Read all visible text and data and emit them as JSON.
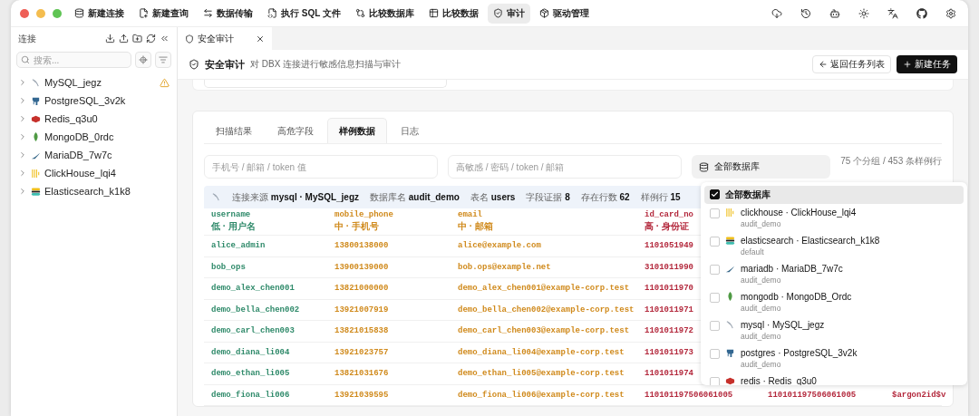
{
  "toolbar": {
    "items": [
      {
        "label": "新建连接",
        "selected": false
      },
      {
        "label": "新建查询",
        "selected": false
      },
      {
        "label": "数据传输",
        "selected": false
      },
      {
        "label": "执行 SQL 文件",
        "selected": false
      },
      {
        "label": "比较数据库",
        "selected": false
      },
      {
        "label": "比较数据",
        "selected": false
      },
      {
        "label": "审计",
        "selected": true
      },
      {
        "label": "驱动管理",
        "selected": false
      }
    ]
  },
  "sidebar": {
    "title": "连接",
    "search": {
      "placeholder": "搜索..."
    },
    "items": [
      {
        "label": "MySQL_jegz",
        "kind": "mysql",
        "warning": true
      },
      {
        "label": "PostgreSQL_3v2k",
        "kind": "postgres",
        "warning": false
      },
      {
        "label": "Redis_q3u0",
        "kind": "redis",
        "warning": false
      },
      {
        "label": "MongoDB_0rdc",
        "kind": "mongodb",
        "warning": false
      },
      {
        "label": "MariaDB_7w7c",
        "kind": "mariadb",
        "warning": false
      },
      {
        "label": "ClickHouse_lqi4",
        "kind": "clickhouse",
        "warning": false
      },
      {
        "label": "Elasticsearch_k1k8",
        "kind": "elasticsearch",
        "warning": false
      }
    ]
  },
  "doc_tab": {
    "label": "安全审计"
  },
  "header": {
    "title": "安全审计",
    "subtitle": "对 DBX 连接进行敏感信息扫描与审计",
    "back_button": "返回任务列表",
    "new_button": "新建任务"
  },
  "tabs": [
    {
      "label": "扫描结果",
      "selected": false
    },
    {
      "label": "高危字段",
      "selected": false
    },
    {
      "label": "样例数据",
      "selected": true
    },
    {
      "label": "日志",
      "selected": false
    }
  ],
  "filters": {
    "value_search": {
      "placeholder": "手机号 / 邮箱 / token 值"
    },
    "field_search": {
      "placeholder": "高敏感 / 密码 / token / 邮箱"
    },
    "database_select": "全部数据库",
    "summary": "75 个分组 / 453 条样例行"
  },
  "info_bar": [
    {
      "label": "连接来源",
      "value": "mysql · MySQL_jegz"
    },
    {
      "label": "数据库名",
      "value": "audit_demo"
    },
    {
      "label": "表名",
      "value": "users"
    },
    {
      "label": "字段证据",
      "value": "8"
    },
    {
      "label": "存在行数",
      "value": "62"
    },
    {
      "label": "样例行",
      "value": "15"
    }
  ],
  "table": {
    "columns": [
      {
        "name": "username",
        "tag": "低 · 用户名",
        "color": "#2f8a6a"
      },
      {
        "name": "mobile_phone",
        "tag": "中 · 手机号",
        "color": "#d08a1c"
      },
      {
        "name": "email",
        "tag": "中 · 邮箱",
        "color": "#d08a1c"
      },
      {
        "name": "id_card_no",
        "tag": "高 · 身份证",
        "color": "#b3283c"
      },
      {
        "color": "#b3283c"
      },
      {
        "color": "#b3283c"
      }
    ],
    "rows": [
      [
        "alice_admin",
        "13800138000",
        "alice@example.com",
        "1101051949"
      ],
      [
        "bob_ops",
        "13900139000",
        "bob.ops@example.net",
        "3101011990"
      ],
      [
        "demo_alex_chen001",
        "13821000000",
        "demo_alex_chen001@example-corp.test",
        "1101011970"
      ],
      [
        "demo_bella_chen002",
        "13921007919",
        "demo_bella_chen002@example-corp.test",
        "1101011971"
      ],
      [
        "demo_carl_chen003",
        "13821015838",
        "demo_carl_chen003@example-corp.test",
        "1101011972"
      ],
      [
        "demo_diana_li004",
        "13921023757",
        "demo_diana_li004@example-corp.test",
        "1101011973"
      ],
      [
        "demo_ethan_li005",
        "13821031676",
        "demo_ethan_li005@example-corp.test",
        "1101011974"
      ],
      [
        "demo_fiona_li006",
        "13921039595",
        "demo_fiona_li006@example-corp.test",
        "110101197506061005",
        "110101197506061005",
        "$argon2id$v"
      ]
    ]
  },
  "database_menu": {
    "items": [
      {
        "label": "全部数据库",
        "checked": true,
        "selected": true
      },
      {
        "label": "clickhouse · ClickHouse_lqi4",
        "sub": "audit_demo",
        "kind": "clickhouse",
        "checked": false,
        "selected": false
      },
      {
        "label": "elasticsearch · Elasticsearch_k1k8",
        "sub": "default",
        "kind": "elasticsearch",
        "checked": false,
        "selected": false
      },
      {
        "label": "mariadb · MariaDB_7w7c",
        "sub": "audit_demo",
        "kind": "mariadb",
        "checked": false,
        "selected": false
      },
      {
        "label": "mongodb · MongoDB_Ordc",
        "sub": "audit_demo",
        "kind": "mongodb",
        "checked": false,
        "selected": false
      },
      {
        "label": "mysql · MySQL_jegz",
        "sub": "audit_demo",
        "kind": "mysql",
        "checked": false,
        "selected": false
      },
      {
        "label": "postgres · PostgreSQL_3v2k",
        "sub": "audit_demo",
        "kind": "postgres",
        "checked": false,
        "selected": false
      },
      {
        "label": "redis · Redis_q3u0",
        "kind": "redis",
        "checked": false,
        "selected": false
      }
    ]
  }
}
